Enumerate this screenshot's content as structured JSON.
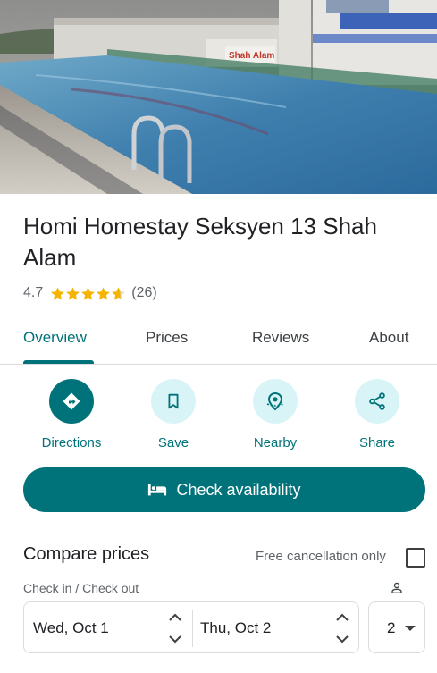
{
  "hotel": {
    "name": "Homi Homestay Seksyen 13 Shah Alam",
    "rating": "4.7",
    "stars": 4.7,
    "review_count": "(26)",
    "hero_sign": "Shah Alam"
  },
  "tabs": [
    {
      "label": "Overview",
      "active": true
    },
    {
      "label": "Prices",
      "active": false
    },
    {
      "label": "Reviews",
      "active": false
    },
    {
      "label": "About",
      "active": false
    }
  ],
  "actions": [
    {
      "label": "Directions",
      "icon": "directions-icon"
    },
    {
      "label": "Save",
      "icon": "bookmark-icon"
    },
    {
      "label": "Nearby",
      "icon": "nearby-icon"
    },
    {
      "label": "Share",
      "icon": "share-icon"
    }
  ],
  "check_availability": {
    "label": "Check availability",
    "icon": "bed-icon"
  },
  "compare": {
    "title": "Compare prices",
    "free_cancellation_label": "Free cancellation only",
    "free_cancellation_checked": false,
    "dates_label": "Check in / Check out",
    "check_in": "Wed, Oct 1",
    "check_out": "Thu, Oct 2",
    "guests": "2"
  },
  "colors": {
    "accent": "#00737a",
    "accent_light": "#d9f4f6",
    "star": "#f4b400",
    "text": "#202124",
    "muted": "#5f6368"
  }
}
